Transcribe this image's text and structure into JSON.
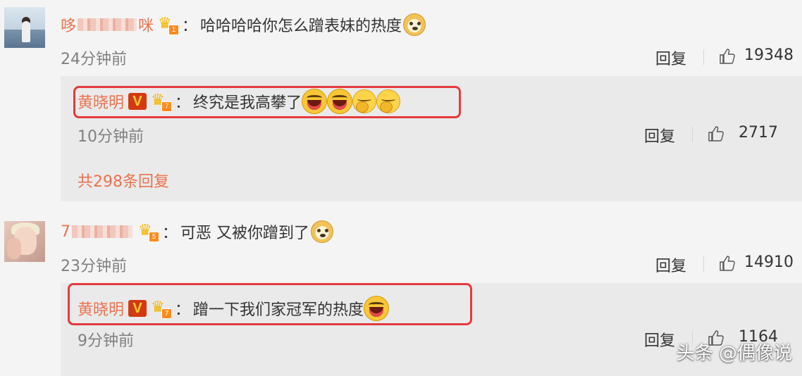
{
  "comments": [
    {
      "username": "哆",
      "username_suffix": "咪",
      "vip_level": "1",
      "colon": "：",
      "text": "哈哈哈哈你怎么蹭表妹的热度",
      "time": "24分钟前",
      "reply_label": "回复",
      "like_count": "19348",
      "reply": {
        "username": "黄晓明",
        "verified_badge": "V",
        "vip_level": "7",
        "colon": "：",
        "text": "终究是我高攀了",
        "time": "10分钟前",
        "reply_label": "回复",
        "like_count": "2717"
      },
      "more_replies": "共298条回复"
    },
    {
      "username": "7",
      "vip_level": "5",
      "colon": "：",
      "text": "可恶 又被你蹭到了",
      "time": "23分钟前",
      "reply_label": "回复",
      "like_count": "14910",
      "reply": {
        "username": "黄晓明",
        "verified_badge": "V",
        "vip_level": "7",
        "colon": "：",
        "text": "蹭一下我们家冠军的热度",
        "time": "9分钟前",
        "reply_label": "回复",
        "like_count": "1164"
      }
    }
  ],
  "icons": {
    "vip": "crown-vip-icon",
    "like": "thumbs-up-icon",
    "doge": "doge-emoji-icon",
    "laugh": "laugh-emoji-icon",
    "yawn": "yawn-emoji-icon"
  },
  "colors": {
    "username": "#eb7350",
    "highlight": "#e33b3f",
    "verified": "#d33a12"
  },
  "watermark": "头条 @偶像说"
}
